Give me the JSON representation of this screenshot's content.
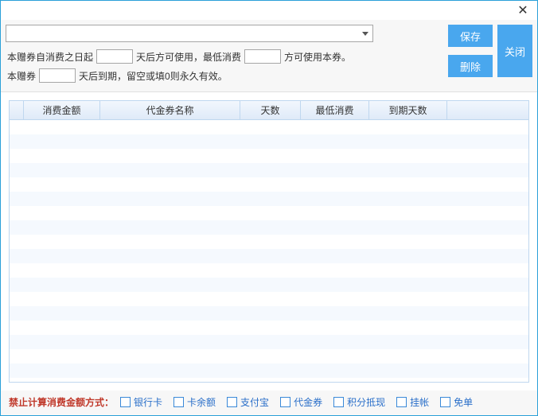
{
  "titlebar": {
    "close_glyph": "✕"
  },
  "combo": {
    "value": ""
  },
  "form": {
    "line1_pre": "本赠券自消费之日起",
    "days_usable": "",
    "line1_mid": "天后方可使用，最低消费",
    "min_spend": "",
    "line1_post": "方可使用本券。",
    "line2_pre": "本赠券",
    "days_expire": "",
    "line2_post": "天后到期，留空或填0则永久有效。"
  },
  "buttons": {
    "save": "保存",
    "delete": "删除",
    "close": "关闭"
  },
  "table": {
    "headers": {
      "row_handle": "",
      "amount": "消费金额",
      "name": "代金券名称",
      "days": "天数",
      "min": "最低消费",
      "expire_days": "到期天数",
      "extra": ""
    }
  },
  "footer": {
    "label": "禁止计算消费金额方式：",
    "options": {
      "bank_card": "银行卡",
      "card_balance": "卡余额",
      "alipay": "支付宝",
      "voucher": "代金券",
      "points": "积分抵现",
      "credit": "挂帐",
      "waive": "免单"
    }
  }
}
